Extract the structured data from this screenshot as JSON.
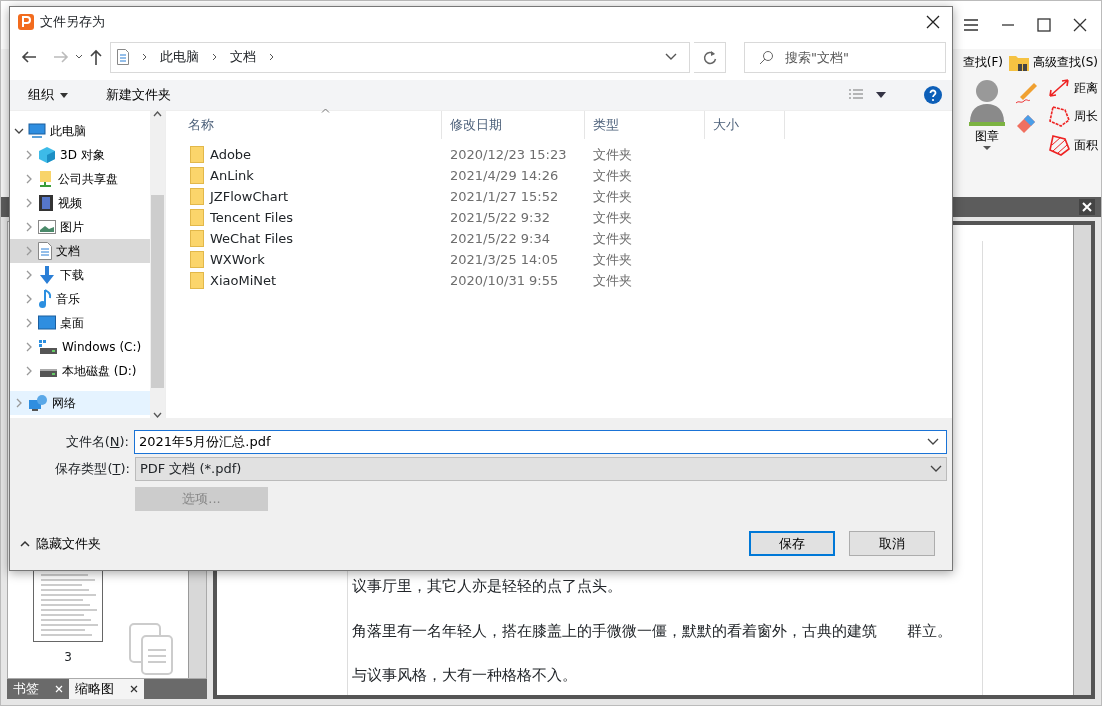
{
  "app": {
    "ribbon": {
      "find": "查找(F)",
      "advanced_find": "高级查找(S)",
      "stamp": "图章",
      "tools": [
        {
          "kind": "distance",
          "label": "距离"
        },
        {
          "kind": "perimeter",
          "label": "周长"
        },
        {
          "kind": "area",
          "label": "面积"
        }
      ]
    },
    "side_panel": {
      "page_number": "3",
      "tabs": [
        {
          "label": "书签",
          "selected": false
        },
        {
          "label": "缩略图",
          "selected": true
        }
      ]
    },
    "document": {
      "paragraphs": [
        "议事厅里，其它人亦是轻轻的点了点头。",
        "角落里有一名年轻人，搭在膝盖上的手微微一僵，默默的看着窗外，古典的建筑　　群立。",
        "与议事风格，大有一种格格不入。"
      ]
    }
  },
  "dialog": {
    "title": "文件另存为",
    "breadcrumb": [
      "此电脑",
      "文档"
    ],
    "search_placeholder": "搜索\"文档\"",
    "toolbar": {
      "organize": "组织",
      "new_folder": "新建文件夹"
    },
    "tree": [
      {
        "label": "此电脑",
        "kind": "pc",
        "expanded": true,
        "selected": false,
        "hovered": false,
        "children": [
          {
            "label": "3D 对象",
            "kind": "cube",
            "expanded": false,
            "selected": false,
            "hovered": false
          },
          {
            "label": "公司共享盘",
            "kind": "share",
            "expanded": false,
            "selected": false,
            "hovered": false
          },
          {
            "label": "视频",
            "kind": "video",
            "expanded": false,
            "selected": false,
            "hovered": false
          },
          {
            "label": "图片",
            "kind": "picture",
            "expanded": false,
            "selected": false,
            "hovered": false
          },
          {
            "label": "文档",
            "kind": "document",
            "expanded": false,
            "selected": true,
            "hovered": false
          },
          {
            "label": "下载",
            "kind": "download",
            "expanded": false,
            "selected": false,
            "hovered": false
          },
          {
            "label": "音乐",
            "kind": "music",
            "expanded": false,
            "selected": false,
            "hovered": false
          },
          {
            "label": "桌面",
            "kind": "desktop",
            "expanded": false,
            "selected": false,
            "hovered": false
          },
          {
            "label": "Windows (C:)",
            "kind": "system-drive",
            "expanded": false,
            "selected": false,
            "hovered": false
          },
          {
            "label": "本地磁盘 (D:)",
            "kind": "drive",
            "expanded": false,
            "selected": false,
            "hovered": false
          }
        ]
      },
      {
        "label": "网络",
        "kind": "network",
        "expanded": false,
        "selected": false,
        "hovered": true
      }
    ],
    "columns": [
      "名称",
      "修改日期",
      "类型",
      "大小"
    ],
    "files": [
      {
        "name": "Adobe",
        "modified": "2020/12/23 15:23",
        "type": "文件夹"
      },
      {
        "name": "AnLink",
        "modified": "2021/4/29 14:26",
        "type": "文件夹"
      },
      {
        "name": "JZFlowChart",
        "modified": "2021/1/27 15:52",
        "type": "文件夹"
      },
      {
        "name": "Tencent Files",
        "modified": "2021/5/22 9:32",
        "type": "文件夹"
      },
      {
        "name": "WeChat Files",
        "modified": "2021/5/22 9:34",
        "type": "文件夹"
      },
      {
        "name": "WXWork",
        "modified": "2021/3/25 14:05",
        "type": "文件夹"
      },
      {
        "name": "XiaoMiNet",
        "modified": "2020/10/31 9:55",
        "type": "文件夹"
      }
    ],
    "filename": {
      "label": "文件名(",
      "access_key": "N",
      "label_end": "):",
      "value": "2021年5月份汇总.pdf"
    },
    "filetype": {
      "label": "保存类型(",
      "access_key": "T",
      "label_end": "):",
      "value": "PDF 文档 (*.pdf)"
    },
    "options_button": {
      "label": "选项...",
      "disabled": true
    },
    "hide_folders": "隐藏文件夹",
    "save": "保存",
    "cancel": "取消"
  }
}
